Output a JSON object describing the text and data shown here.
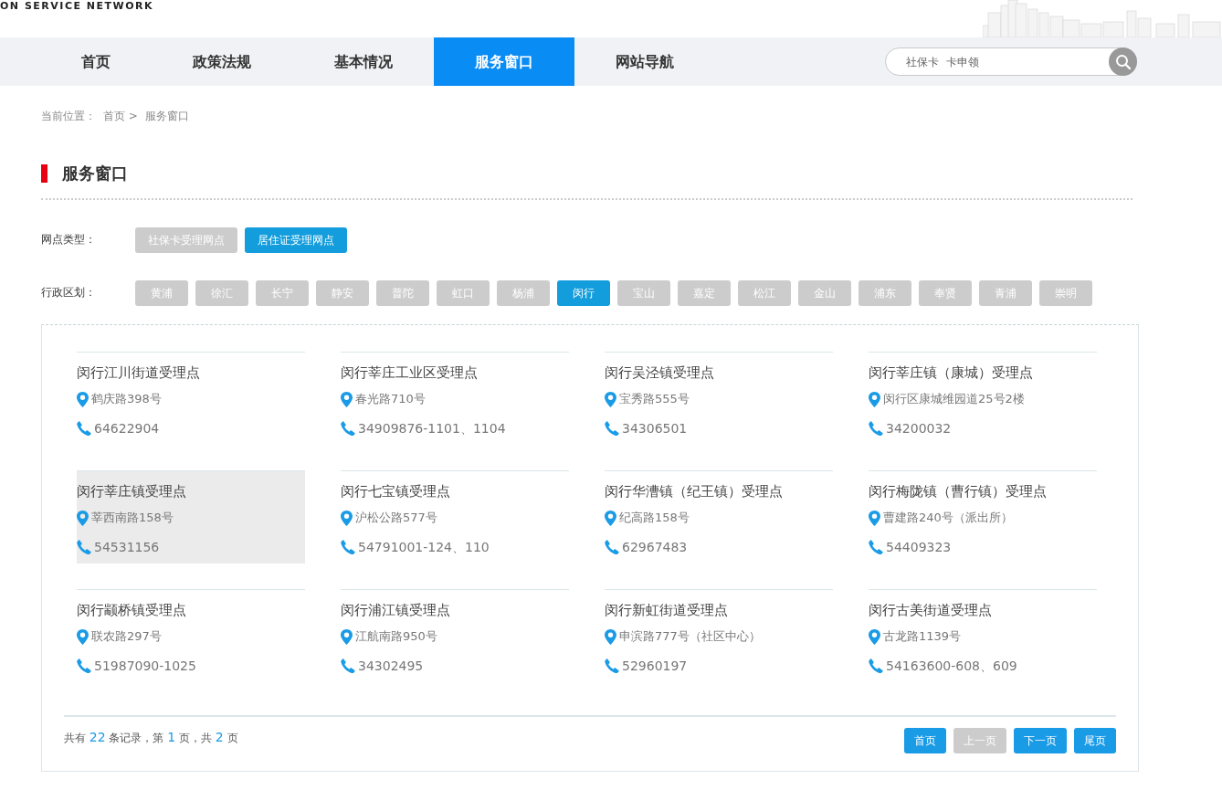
{
  "header": {
    "logo_text": "ON SERVICE NETWORK"
  },
  "nav": [
    {
      "label": "首页",
      "selected": false
    },
    {
      "label": "政策法规",
      "selected": false
    },
    {
      "label": "基本情况",
      "selected": false
    },
    {
      "label": "服务窗口",
      "selected": true
    },
    {
      "label": "网站导航",
      "selected": false
    }
  ],
  "search": {
    "placeholder": "社保卡  卡申领"
  },
  "breadcrumb": {
    "label": "当前位置：",
    "items": [
      "首页 >",
      "服务窗口"
    ]
  },
  "section_title": "服务窗口",
  "filters": [
    {
      "label": "网点类型：",
      "options": [
        {
          "label": "社保卡受理网点",
          "selected": false
        },
        {
          "label": "居住证受理网点",
          "selected": true
        }
      ]
    },
    {
      "label": "行政区划：",
      "options": [
        {
          "label": "黄浦",
          "selected": false
        },
        {
          "label": "徐汇",
          "selected": false
        },
        {
          "label": "长宁",
          "selected": false
        },
        {
          "label": "静安",
          "selected": false
        },
        {
          "label": "普陀",
          "selected": false
        },
        {
          "label": "虹口",
          "selected": false
        },
        {
          "label": "杨浦",
          "selected": false
        },
        {
          "label": "闵行",
          "selected": true
        },
        {
          "label": "宝山",
          "selected": false
        },
        {
          "label": "嘉定",
          "selected": false
        },
        {
          "label": "松江",
          "selected": false
        },
        {
          "label": "金山",
          "selected": false
        },
        {
          "label": "浦东",
          "selected": false
        },
        {
          "label": "奉贤",
          "selected": false
        },
        {
          "label": "青浦",
          "selected": false
        },
        {
          "label": "崇明",
          "selected": false
        }
      ]
    }
  ],
  "service_points": [
    {
      "name": "闵行江川街道受理点",
      "address": "鹤庆路398号",
      "phone": "64622904",
      "hovered": false
    },
    {
      "name": "闵行莘庄工业区受理点",
      "address": "春光路710号",
      "phone": "34909876-1101、1104",
      "hovered": false
    },
    {
      "name": "闵行吴泾镇受理点",
      "address": "宝秀路555号",
      "phone": "34306501",
      "hovered": false
    },
    {
      "name": "闵行莘庄镇（康城）受理点",
      "address": "闵行区康城维园道25号2楼",
      "phone": "34200032",
      "hovered": false
    },
    {
      "name": "闵行莘庄镇受理点",
      "address": "莘西南路158号",
      "phone": "54531156",
      "hovered": true
    },
    {
      "name": "闵行七宝镇受理点",
      "address": "沪松公路577号",
      "phone": "54791001-124、110",
      "hovered": false
    },
    {
      "name": "闵行华漕镇（纪王镇）受理点",
      "address": "纪高路158号",
      "phone": "62967483",
      "hovered": false
    },
    {
      "name": "闵行梅陇镇（曹行镇）受理点",
      "address": "曹建路240号（派出所）",
      "phone": "54409323",
      "hovered": false
    },
    {
      "name": "闵行颛桥镇受理点",
      "address": "联农路297号",
      "phone": "51987090-1025",
      "hovered": false
    },
    {
      "name": "闵行浦江镇受理点",
      "address": "江航南路950号",
      "phone": "34302495",
      "hovered": false
    },
    {
      "name": "闵行新虹街道受理点",
      "address": "申滨路777号（社区中心）",
      "phone": "52960197",
      "hovered": false
    },
    {
      "name": "闵行古美街道受理点",
      "address": "古龙路1139号",
      "phone": "54163600-608、609",
      "hovered": false
    }
  ],
  "pagination": {
    "summary": [
      {
        "kind": "text",
        "text": "共有 "
      },
      {
        "kind": "number",
        "text": "22"
      },
      {
        "kind": "text",
        "text": " 条记录，第 "
      },
      {
        "kind": "number",
        "text": "1"
      },
      {
        "kind": "text",
        "text": " 页，共 "
      },
      {
        "kind": "number",
        "text": "2"
      },
      {
        "kind": "text",
        "text": " 页"
      }
    ],
    "buttons": [
      {
        "label": "首页",
        "disabled": false
      },
      {
        "label": "上一页",
        "disabled": true
      },
      {
        "label": "下一页",
        "disabled": false
      },
      {
        "label": "尾页",
        "disabled": false
      }
    ]
  }
}
